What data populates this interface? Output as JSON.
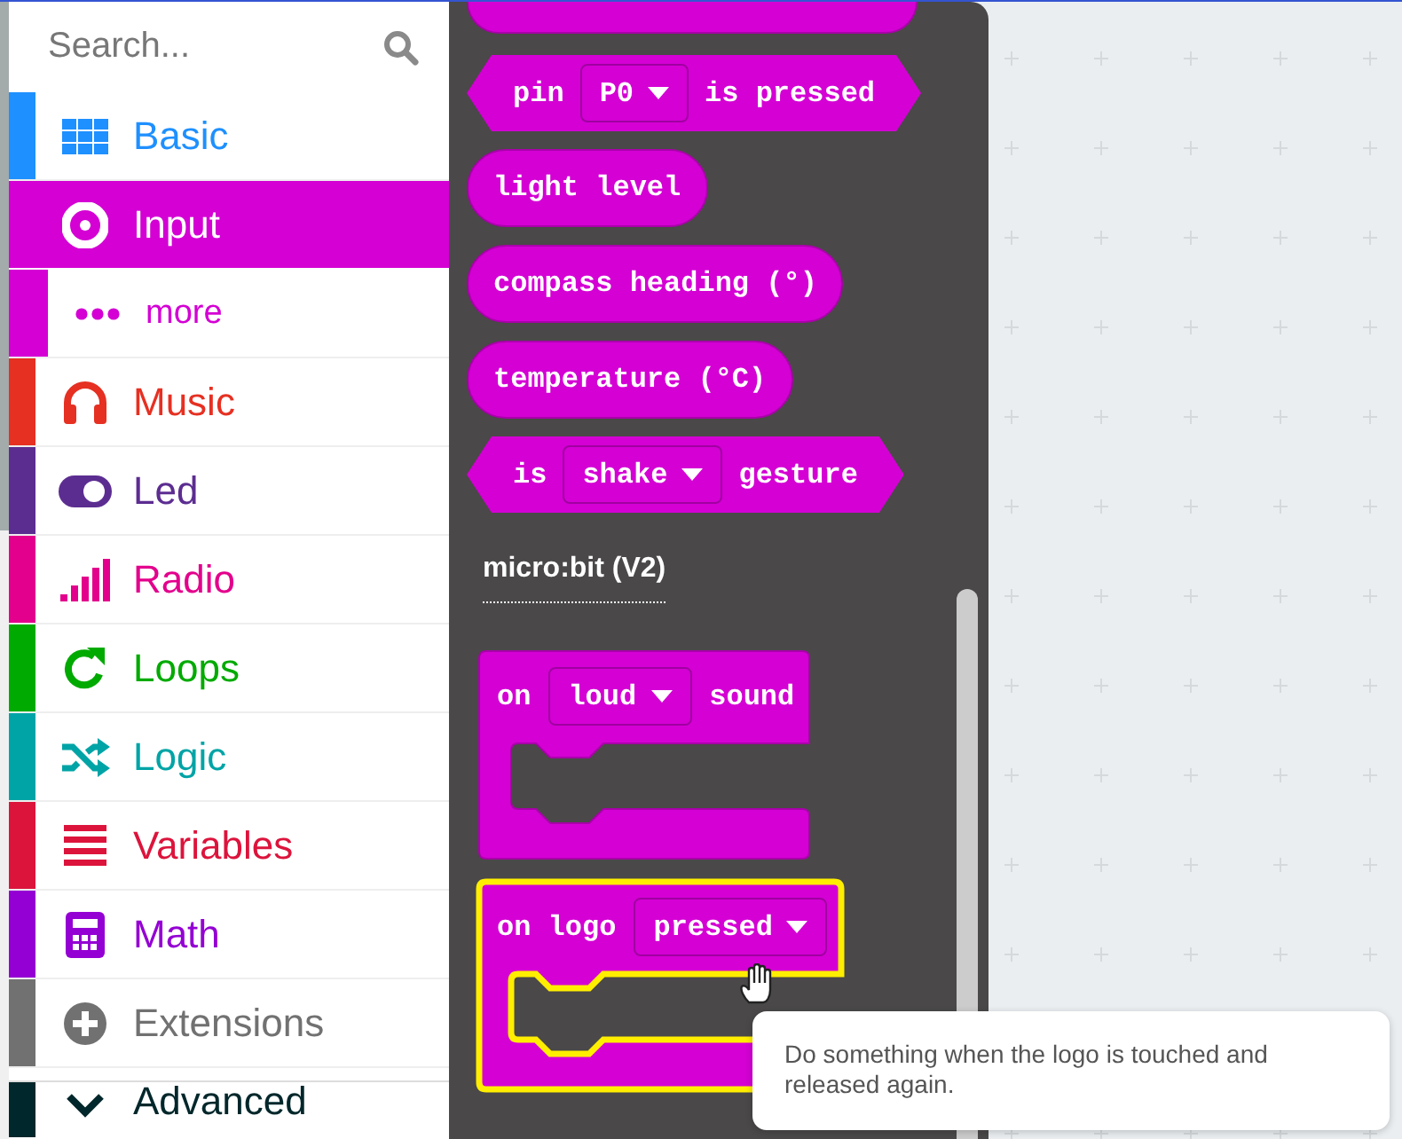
{
  "search": {
    "placeholder": "Search..."
  },
  "categories": [
    {
      "kind": "category",
      "label": "Basic",
      "color": "#1e90ff",
      "selected": false
    },
    {
      "kind": "category",
      "label": "Input",
      "color": "#d400d4",
      "selected": true
    },
    {
      "kind": "subcategory",
      "label": "more",
      "color": "#d400d4",
      "selected": false
    },
    {
      "kind": "category",
      "label": "Music",
      "color": "#e63022",
      "selected": false
    },
    {
      "kind": "category",
      "label": "Led",
      "color": "#5c2d91",
      "selected": false
    },
    {
      "kind": "category",
      "label": "Radio",
      "color": "#e3008c",
      "selected": false
    },
    {
      "kind": "category",
      "label": "Loops",
      "color": "#00aa00",
      "selected": false
    },
    {
      "kind": "category",
      "label": "Logic",
      "color": "#00a4a6",
      "selected": false
    },
    {
      "kind": "category",
      "label": "Variables",
      "color": "#dc143c",
      "selected": false
    },
    {
      "kind": "category",
      "label": "Math",
      "color": "#9400d3",
      "selected": false
    },
    {
      "kind": "category",
      "label": "Extensions",
      "color": "#717171",
      "selected": false
    }
  ],
  "advanced": {
    "label": "Advanced",
    "color": "#00272b"
  },
  "blocks": [
    {
      "kind": "edge"
    },
    {
      "kind": "boolean",
      "pieces": [
        {
          "kind": "text",
          "text": "pin"
        },
        {
          "kind": "dropdown",
          "text": "P0"
        },
        {
          "kind": "text",
          "text": "is pressed"
        }
      ]
    },
    {
      "kind": "reporter",
      "pieces": [
        {
          "kind": "text",
          "text": "light level"
        }
      ]
    },
    {
      "kind": "reporter",
      "pieces": [
        {
          "kind": "text",
          "text": "compass heading (°)"
        }
      ]
    },
    {
      "kind": "reporter",
      "pieces": [
        {
          "kind": "text",
          "text": "temperature (°C)"
        }
      ]
    },
    {
      "kind": "boolean",
      "pieces": [
        {
          "kind": "text",
          "text": "is"
        },
        {
          "kind": "dropdown",
          "text": "shake"
        },
        {
          "kind": "text",
          "text": "gesture"
        }
      ]
    },
    {
      "kind": "heading",
      "text": "micro:bit (V2)"
    },
    {
      "kind": "event",
      "selected": false,
      "pieces": [
        {
          "kind": "text",
          "text": "on"
        },
        {
          "kind": "dropdown",
          "text": "loud"
        },
        {
          "kind": "text",
          "text": "sound"
        }
      ]
    },
    {
      "kind": "event",
      "selected": true,
      "pieces": [
        {
          "kind": "text",
          "text": "on logo"
        },
        {
          "kind": "dropdown",
          "text": "pressed"
        }
      ]
    }
  ],
  "tooltip": {
    "text": "Do something when the logo is touched and released again."
  }
}
